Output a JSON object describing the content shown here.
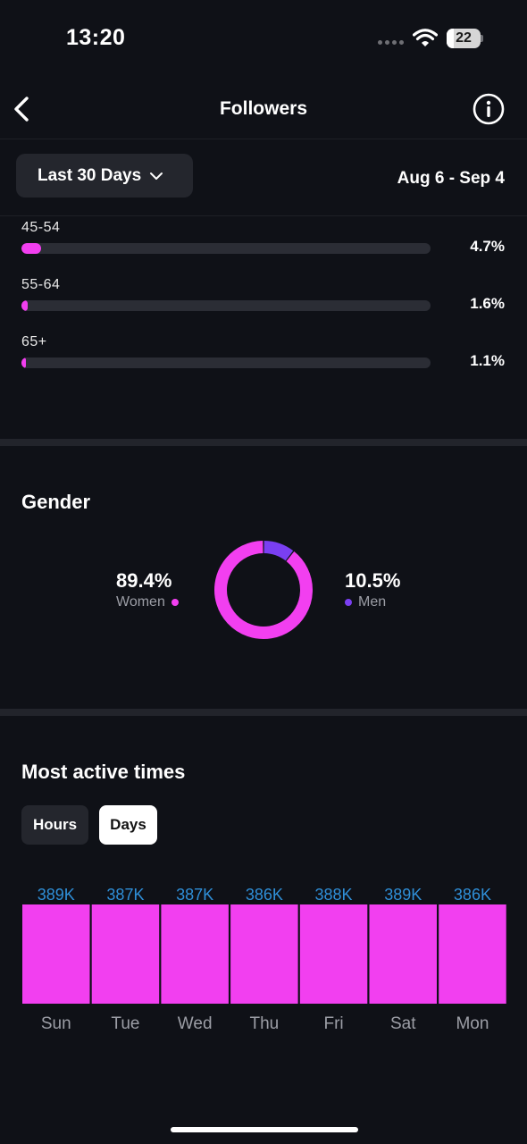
{
  "status_bar": {
    "time": "13:20",
    "battery": "22"
  },
  "nav": {
    "title": "Followers"
  },
  "filter": {
    "range_label": "Last 30 Days",
    "date_range": "Aug 6 - Sep 4"
  },
  "age_groups": [
    {
      "label": "45-54",
      "percent": 4.7,
      "display": "4.7%"
    },
    {
      "label": "55-64",
      "percent": 1.6,
      "display": "1.6%"
    },
    {
      "label": "65+",
      "percent": 1.1,
      "display": "1.1%"
    }
  ],
  "gender": {
    "title": "Gender",
    "women": {
      "value": "89.4%",
      "label": "Women",
      "color": "#f23ff0"
    },
    "men": {
      "value": "10.5%",
      "label": "Men",
      "color": "#7a3ff2"
    }
  },
  "active_times": {
    "title": "Most active times",
    "tabs": {
      "hours": "Hours",
      "days": "Days"
    },
    "selected_tab": "Days"
  },
  "chart_data": [
    {
      "type": "pie",
      "categories": [
        "Women",
        "Men"
      ],
      "values": [
        89.4,
        10.5
      ],
      "colors": [
        "#f23ff0",
        "#7a3ff2"
      ]
    },
    {
      "type": "bar",
      "categories": [
        "Sun",
        "Tue",
        "Wed",
        "Thu",
        "Fri",
        "Sat",
        "Mon"
      ],
      "values": [
        389000,
        387000,
        387000,
        386000,
        388000,
        389000,
        386000
      ],
      "labels": [
        "389K",
        "387K",
        "387K",
        "386K",
        "388K",
        "389K",
        "386K"
      ],
      "bar_color": "#f23ff0",
      "label_color": "#2f8fd8"
    }
  ]
}
